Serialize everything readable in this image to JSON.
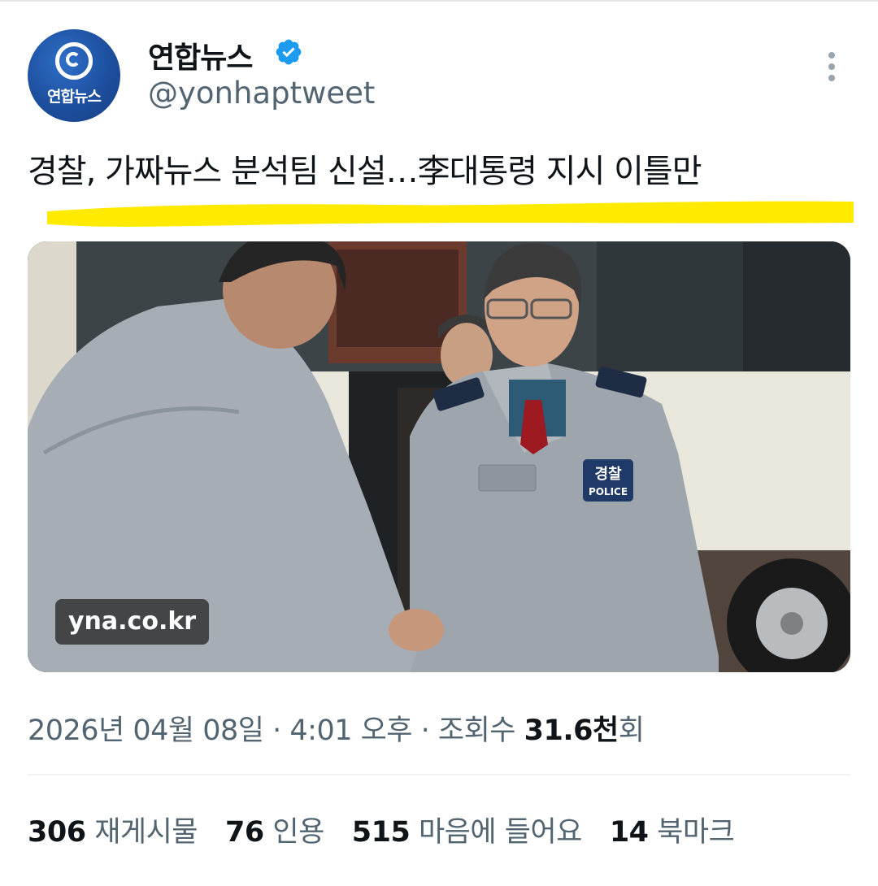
{
  "account": {
    "display_name": "연합뉴스",
    "handle": "@yonhaptweet",
    "avatar_text": "연합뉴스"
  },
  "headline": "경찰, 가짜뉴스 분석팀 신설…李대통령 지시 이틀만",
  "media": {
    "source_tag": "yna.co.kr",
    "badge_text_top": "경찰",
    "badge_text_bottom": "POLICE"
  },
  "meta": {
    "date": "2026년 04월 08일",
    "sep1": " · ",
    "time": "4:01 오후",
    "sep2": " · ",
    "views_label": "조회수 ",
    "views_value": "31.6천",
    "views_suffix": "회"
  },
  "stats": {
    "reposts_count": "306",
    "reposts_label": "재게시물",
    "quotes_count": "76",
    "quotes_label": "인용",
    "likes_count": "515",
    "likes_label": "마음에 들어요",
    "bookmarks_count": "14",
    "bookmarks_label": "북마크"
  },
  "colors": {
    "verified": "#1d9bf0",
    "highlight": "#ffea00",
    "secondary_text": "#536471",
    "primary_text": "#0f1419"
  },
  "icons": [
    "verified-badge-icon",
    "more-options-icon"
  ]
}
